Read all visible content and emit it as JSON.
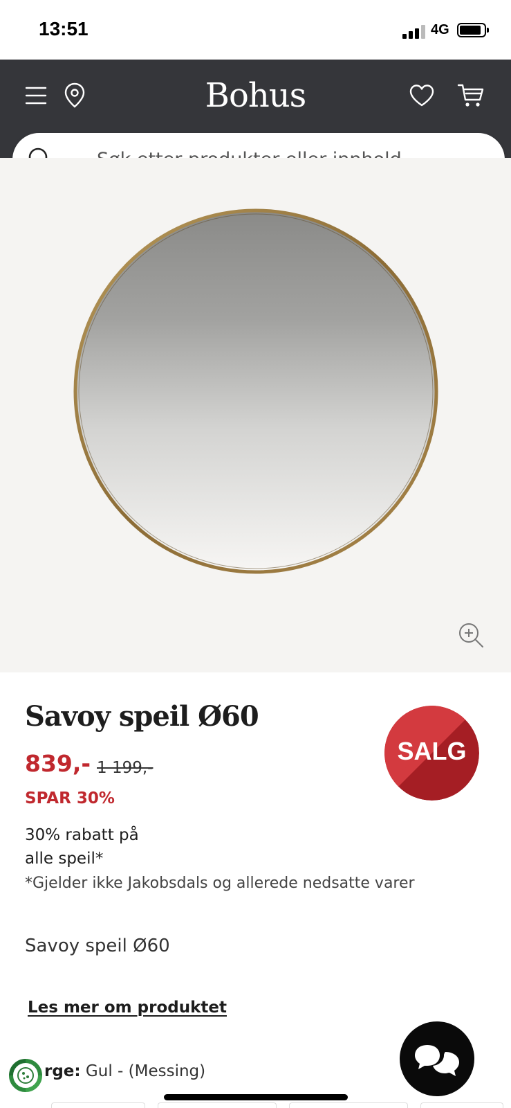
{
  "status": {
    "time": "13:51",
    "network": "4G"
  },
  "header": {
    "logo": "Bohus",
    "menu_icon": "hamburger-menu-icon",
    "location_icon": "map-pin-icon",
    "wishlist_icon": "heart-icon",
    "cart_icon": "shopping-cart-icon",
    "background": "#35363a"
  },
  "search": {
    "placeholder": "Søk etter produkter eller innhold...",
    "value": ""
  },
  "product": {
    "title": "Savoy speil Ø60",
    "price": "839,-",
    "old_price": "1 199,-",
    "save": "SPAR 30%",
    "badge": "SALG",
    "promo_line1": "30% rabatt på",
    "promo_line2": "alle speil*",
    "disclaimer": "*Gjelder ikke Jakobsdals og allerede nedsatte varer",
    "description": "Savoy speil Ø60",
    "read_more": "Les mer om produktet",
    "color_label": "rge:",
    "color_value": "Gul - (Messing)"
  },
  "colors": {
    "accent": "#c0282e",
    "badge_light": "#d33a3f",
    "badge_dark": "#a51e24",
    "frame": "#a8864a"
  }
}
